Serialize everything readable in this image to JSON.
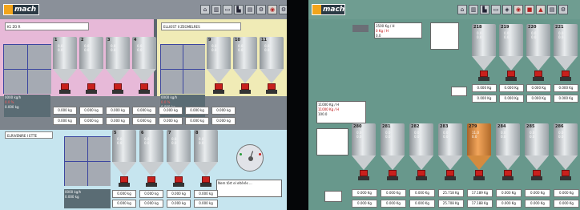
{
  "left": {
    "logo": "mach",
    "zone_top_left": "K1 ZO R",
    "zone_top_right": "ELLIOST II ZEGMELRES",
    "zone_bottom_left": "ELRIVENIRE I ETTE",
    "silos_top_left": [
      {
        "num": "1",
        "v1": "0.0",
        "v2": "0.0"
      },
      {
        "num": "2",
        "v1": "0.0",
        "v2": "0.0"
      },
      {
        "num": "3",
        "v1": "0.0",
        "v2": "0.0"
      },
      {
        "num": "4",
        "v1": "0.0",
        "v2": "0.0"
      }
    ],
    "silos_top_right": [
      {
        "num": "9",
        "v1": "0.0",
        "v2": "0.0"
      },
      {
        "num": "10",
        "v1": "0.0",
        "v2": "0.0"
      },
      {
        "num": "11",
        "v1": "0.0",
        "v2": "0.0"
      }
    ],
    "silos_bottom": [
      {
        "num": "5",
        "v1": "0.0",
        "v2": "0.0"
      },
      {
        "num": "6",
        "v1": "0.0",
        "v2": "0.0"
      },
      {
        "num": "7",
        "v1": "0.0",
        "v2": "0.0"
      },
      {
        "num": "8",
        "v1": "0.0",
        "v2": "0.0"
      }
    ],
    "weights_top": [
      "0.000 kg",
      "0.000 kg",
      "0.000 kg",
      "0.000 kg",
      "0.000 kg",
      "0.000 kg",
      "0.000 kg"
    ],
    "weights_bottom": [
      "0.000 kg",
      "0.000 kg",
      "0.000 kg",
      "0.000 kg"
    ],
    "info_top_left": {
      "line1": "0000 kg/h",
      "line2": "0.0 %",
      "line3": "0.000 kg"
    },
    "info_top_right": {
      "line1": "0000 kg/h",
      "line2": "0.0 %",
      "line3": "0.000 kg"
    },
    "info_bottom_left": {
      "line1": "0000 kg/h",
      "line2": "0.000 kg"
    },
    "gauge_note": "Nem tört el eltérés ..."
  },
  "right": {
    "logo": "mach",
    "setpoint_top": "3500 Kg / H",
    "actual_top": "0 Kg / H",
    "percent_top": "0.0",
    "setpoint_mid": "11000 Kg / H",
    "actual_mid": "11000 Kg / H",
    "percent_mid": "100.0",
    "silos_top": [
      {
        "num": "218",
        "v1": "0.0",
        "v2": "0.0"
      },
      {
        "num": "219",
        "v1": "0.0",
        "v2": "0.0"
      },
      {
        "num": "220",
        "v1": "0.0",
        "v2": "0.0"
      },
      {
        "num": "221",
        "v1": "0.0",
        "v2": "0.0"
      }
    ],
    "weights_top": [
      "0.000 Kg",
      "0.000 Kg",
      "0.000 Kg",
      "0.000 Kg"
    ],
    "weights_top2": [
      "0.000 Kg",
      "0.000 Kg",
      "0.000 Kg",
      "0.000 Kg"
    ],
    "silos_bottom": [
      {
        "num": "280",
        "v1": "0.0",
        "v2": "0.0",
        "orange": false
      },
      {
        "num": "281",
        "v1": "0.0",
        "v2": "0.0",
        "orange": false
      },
      {
        "num": "282",
        "v1": "0.0",
        "v2": "0.0",
        "orange": false
      },
      {
        "num": "283",
        "v1": "0.0",
        "v2": "0.0",
        "orange": false
      },
      {
        "num": "279",
        "v1": "11.0",
        "v2": "0.0",
        "orange": true
      },
      {
        "num": "284",
        "v1": "0.0",
        "v2": "0.0",
        "orange": false
      },
      {
        "num": "285",
        "v1": "0.0",
        "v2": "0.0",
        "orange": false
      },
      {
        "num": "286",
        "v1": "0.0",
        "v2": "0.0",
        "orange": false
      }
    ],
    "weights_bottom": [
      "0.000 Kg",
      "0.000 Kg",
      "0.000 Kg",
      "25.718 Kg",
      "17.189 Kg",
      "0.000 Kg",
      "0.000 Kg",
      "0.000 Kg"
    ],
    "weights_bottom2": [
      "0.000 Kg",
      "0.000 Kg",
      "0.000 Kg",
      "25.708 Kg",
      "17.188 Kg",
      "0.000 Kg",
      "0.000 Kg",
      "0.000 Kg"
    ]
  }
}
